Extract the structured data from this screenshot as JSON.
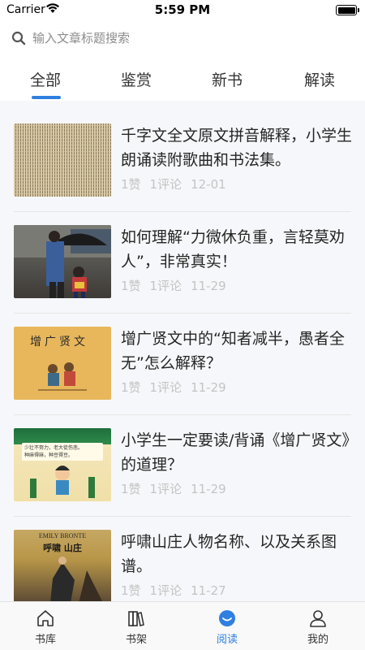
{
  "status_bar": {
    "carrier": "Carrier",
    "time": "5:59 PM"
  },
  "search": {
    "placeholder": "输入文章标题搜索"
  },
  "tabs": [
    {
      "label": "全部",
      "active": true
    },
    {
      "label": "鉴赏",
      "active": false
    },
    {
      "label": "新书",
      "active": false
    },
    {
      "label": "解读",
      "active": false
    }
  ],
  "articles": [
    {
      "title": "千字文全文原文拼音解释，小学生朗诵读附歌曲和书法集。",
      "likes": "1赞",
      "comments": "1评论",
      "date": "12-01",
      "thumb": "ancient-text"
    },
    {
      "title": "如何理解“力微休负重，言轻莫劝人”，非常真实！",
      "likes": "1赞",
      "comments": "1评论",
      "date": "11-29",
      "thumb": "umbrella-photo"
    },
    {
      "title": "增广贤文中的“知者减半，愚者全无”怎么解释？",
      "likes": "1赞",
      "comments": "1评论",
      "date": "11-29",
      "thumb": "book-cover",
      "thumb_text": "增广贤文"
    },
    {
      "title": "小学生一定要读/背诵《增广贤文》的道理？",
      "likes": "1赞",
      "comments": "1评论",
      "date": "11-29",
      "thumb": "cartoon-boy",
      "thumb_text": [
        "少壮不努力，老大徒伤悲。",
        "种麻得麻，种豆得豆。"
      ]
    },
    {
      "title": "呼啸山庄人物名称、以及关系图谱。",
      "likes": "1赞",
      "comments": "1评论",
      "date": "11-27",
      "thumb": "novel-cover",
      "thumb_text": [
        "EMILY BRONTE",
        "呼啸 山庄"
      ]
    }
  ],
  "bottom_nav": [
    {
      "label": "书库",
      "icon": "home-icon",
      "active": false
    },
    {
      "label": "书架",
      "icon": "bookshelf-icon",
      "active": false
    },
    {
      "label": "阅读",
      "icon": "reading-icon",
      "active": true
    },
    {
      "label": "我的",
      "icon": "profile-icon",
      "active": false
    }
  ],
  "colors": {
    "accent": "#2f7fe0",
    "list_bg": "#f6f7fa",
    "meta_text": "#c4c4c4"
  }
}
